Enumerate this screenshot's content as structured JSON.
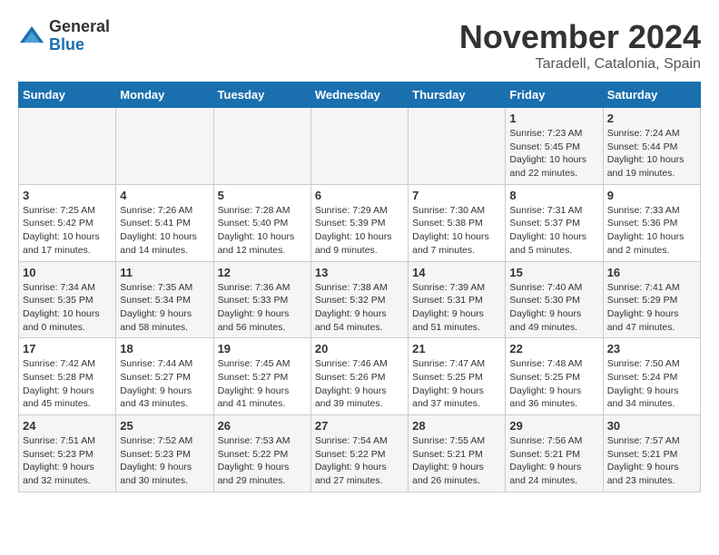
{
  "header": {
    "logo_general": "General",
    "logo_blue": "Blue",
    "month_title": "November 2024",
    "location": "Taradell, Catalonia, Spain"
  },
  "weekdays": [
    "Sunday",
    "Monday",
    "Tuesday",
    "Wednesday",
    "Thursday",
    "Friday",
    "Saturday"
  ],
  "weeks": [
    [
      {
        "day": "",
        "info": ""
      },
      {
        "day": "",
        "info": ""
      },
      {
        "day": "",
        "info": ""
      },
      {
        "day": "",
        "info": ""
      },
      {
        "day": "",
        "info": ""
      },
      {
        "day": "1",
        "info": "Sunrise: 7:23 AM\nSunset: 5:45 PM\nDaylight: 10 hours and 22 minutes."
      },
      {
        "day": "2",
        "info": "Sunrise: 7:24 AM\nSunset: 5:44 PM\nDaylight: 10 hours and 19 minutes."
      }
    ],
    [
      {
        "day": "3",
        "info": "Sunrise: 7:25 AM\nSunset: 5:42 PM\nDaylight: 10 hours and 17 minutes."
      },
      {
        "day": "4",
        "info": "Sunrise: 7:26 AM\nSunset: 5:41 PM\nDaylight: 10 hours and 14 minutes."
      },
      {
        "day": "5",
        "info": "Sunrise: 7:28 AM\nSunset: 5:40 PM\nDaylight: 10 hours and 12 minutes."
      },
      {
        "day": "6",
        "info": "Sunrise: 7:29 AM\nSunset: 5:39 PM\nDaylight: 10 hours and 9 minutes."
      },
      {
        "day": "7",
        "info": "Sunrise: 7:30 AM\nSunset: 5:38 PM\nDaylight: 10 hours and 7 minutes."
      },
      {
        "day": "8",
        "info": "Sunrise: 7:31 AM\nSunset: 5:37 PM\nDaylight: 10 hours and 5 minutes."
      },
      {
        "day": "9",
        "info": "Sunrise: 7:33 AM\nSunset: 5:36 PM\nDaylight: 10 hours and 2 minutes."
      }
    ],
    [
      {
        "day": "10",
        "info": "Sunrise: 7:34 AM\nSunset: 5:35 PM\nDaylight: 10 hours and 0 minutes."
      },
      {
        "day": "11",
        "info": "Sunrise: 7:35 AM\nSunset: 5:34 PM\nDaylight: 9 hours and 58 minutes."
      },
      {
        "day": "12",
        "info": "Sunrise: 7:36 AM\nSunset: 5:33 PM\nDaylight: 9 hours and 56 minutes."
      },
      {
        "day": "13",
        "info": "Sunrise: 7:38 AM\nSunset: 5:32 PM\nDaylight: 9 hours and 54 minutes."
      },
      {
        "day": "14",
        "info": "Sunrise: 7:39 AM\nSunset: 5:31 PM\nDaylight: 9 hours and 51 minutes."
      },
      {
        "day": "15",
        "info": "Sunrise: 7:40 AM\nSunset: 5:30 PM\nDaylight: 9 hours and 49 minutes."
      },
      {
        "day": "16",
        "info": "Sunrise: 7:41 AM\nSunset: 5:29 PM\nDaylight: 9 hours and 47 minutes."
      }
    ],
    [
      {
        "day": "17",
        "info": "Sunrise: 7:42 AM\nSunset: 5:28 PM\nDaylight: 9 hours and 45 minutes."
      },
      {
        "day": "18",
        "info": "Sunrise: 7:44 AM\nSunset: 5:27 PM\nDaylight: 9 hours and 43 minutes."
      },
      {
        "day": "19",
        "info": "Sunrise: 7:45 AM\nSunset: 5:27 PM\nDaylight: 9 hours and 41 minutes."
      },
      {
        "day": "20",
        "info": "Sunrise: 7:46 AM\nSunset: 5:26 PM\nDaylight: 9 hours and 39 minutes."
      },
      {
        "day": "21",
        "info": "Sunrise: 7:47 AM\nSunset: 5:25 PM\nDaylight: 9 hours and 37 minutes."
      },
      {
        "day": "22",
        "info": "Sunrise: 7:48 AM\nSunset: 5:25 PM\nDaylight: 9 hours and 36 minutes."
      },
      {
        "day": "23",
        "info": "Sunrise: 7:50 AM\nSunset: 5:24 PM\nDaylight: 9 hours and 34 minutes."
      }
    ],
    [
      {
        "day": "24",
        "info": "Sunrise: 7:51 AM\nSunset: 5:23 PM\nDaylight: 9 hours and 32 minutes."
      },
      {
        "day": "25",
        "info": "Sunrise: 7:52 AM\nSunset: 5:23 PM\nDaylight: 9 hours and 30 minutes."
      },
      {
        "day": "26",
        "info": "Sunrise: 7:53 AM\nSunset: 5:22 PM\nDaylight: 9 hours and 29 minutes."
      },
      {
        "day": "27",
        "info": "Sunrise: 7:54 AM\nSunset: 5:22 PM\nDaylight: 9 hours and 27 minutes."
      },
      {
        "day": "28",
        "info": "Sunrise: 7:55 AM\nSunset: 5:21 PM\nDaylight: 9 hours and 26 minutes."
      },
      {
        "day": "29",
        "info": "Sunrise: 7:56 AM\nSunset: 5:21 PM\nDaylight: 9 hours and 24 minutes."
      },
      {
        "day": "30",
        "info": "Sunrise: 7:57 AM\nSunset: 5:21 PM\nDaylight: 9 hours and 23 minutes."
      }
    ]
  ]
}
